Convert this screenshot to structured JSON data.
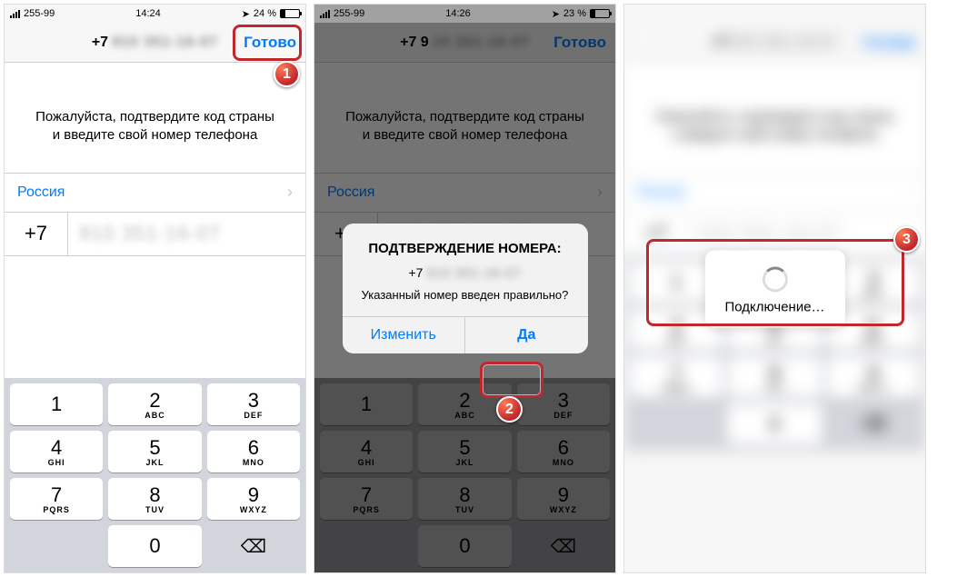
{
  "s1": {
    "carrier": "255-99",
    "time": "14:24",
    "battery_pct": "24 %",
    "title_prefix": "+7",
    "title_blur": "910 351-16-07",
    "done": "Готово",
    "instruction": "Пожалуйста, подтвердите код страны и введите свой номер телефона",
    "country": "Россия",
    "cc": "+7",
    "phone_blur": "910 351-16-07"
  },
  "s2": {
    "carrier": "255-99",
    "time": "14:26",
    "battery_pct": "23 %",
    "title_prefix": "+7 9",
    "title_blur": "10 351-16-07",
    "done": "Готово",
    "alert_title": "ПОДТВЕРЖДЕНИЕ НОМЕРА:",
    "alert_prefix": "+7",
    "alert_blur": "910 351-16-07",
    "alert_msg": "Указанный номер введен правильно?",
    "btn_change": "Изменить",
    "btn_yes": "Да"
  },
  "s3": {
    "loading": "Подключение…"
  },
  "keys": [
    {
      "d": "1",
      "s": ""
    },
    {
      "d": "2",
      "s": "ABC"
    },
    {
      "d": "3",
      "s": "DEF"
    },
    {
      "d": "4",
      "s": "GHI"
    },
    {
      "d": "5",
      "s": "JKL"
    },
    {
      "d": "6",
      "s": "MNO"
    },
    {
      "d": "7",
      "s": "PQRS"
    },
    {
      "d": "8",
      "s": "TUV"
    },
    {
      "d": "9",
      "s": "WXYZ"
    },
    {
      "d": "",
      "s": ""
    },
    {
      "d": "0",
      "s": ""
    },
    {
      "d": "⌫",
      "s": ""
    }
  ],
  "badges": {
    "b1": "1",
    "b2": "2",
    "b3": "3"
  }
}
